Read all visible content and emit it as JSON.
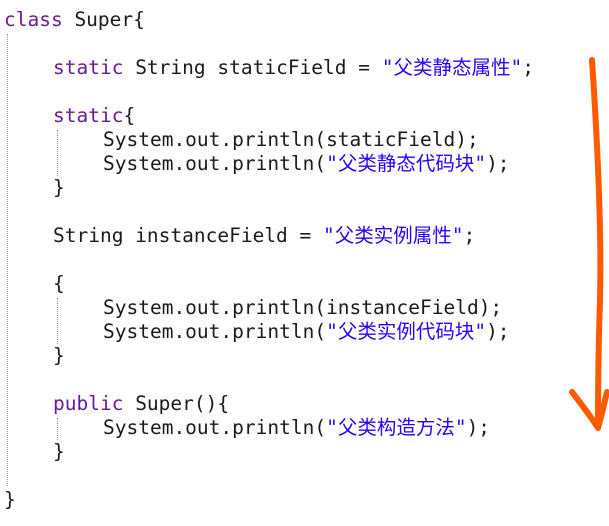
{
  "code": {
    "lines": [
      {
        "id": "l1",
        "parts": [
          "class",
          " Super",
          "{"
        ]
      },
      {
        "id": "l2",
        "parts": [
          "static",
          " String staticField = ",
          "\"父类静态属性\"",
          ";"
        ]
      },
      {
        "id": "l3",
        "parts": [
          "static",
          "{"
        ]
      },
      {
        "id": "l4",
        "parts": [
          "System.out.println",
          "(staticField);"
        ]
      },
      {
        "id": "l5",
        "parts": [
          "System.out.println",
          "(",
          "\"父类静态代码块\"",
          ");"
        ]
      },
      {
        "id": "l6",
        "parts": [
          "}"
        ]
      },
      {
        "id": "l7",
        "parts": [
          "String instanceField = ",
          "\"父类实例属性\"",
          ";"
        ]
      },
      {
        "id": "l8",
        "parts": [
          "{"
        ]
      },
      {
        "id": "l9",
        "parts": [
          "System.out.println",
          "(instanceField);"
        ]
      },
      {
        "id": "l10",
        "parts": [
          "System.out.println",
          "(",
          "\"父类实例代码块\"",
          ");"
        ]
      },
      {
        "id": "l11",
        "parts": [
          "}"
        ]
      },
      {
        "id": "l12",
        "parts": [
          "public",
          " Super(){"
        ]
      },
      {
        "id": "l13",
        "parts": [
          "System.out.println",
          "(",
          "\"父类构造方法\"",
          ");"
        ]
      },
      {
        "id": "l14",
        "parts": [
          "}"
        ]
      },
      {
        "id": "l15",
        "parts": [
          "}"
        ]
      }
    ]
  },
  "annotation": {
    "arrow_color": "#ff5a00"
  }
}
